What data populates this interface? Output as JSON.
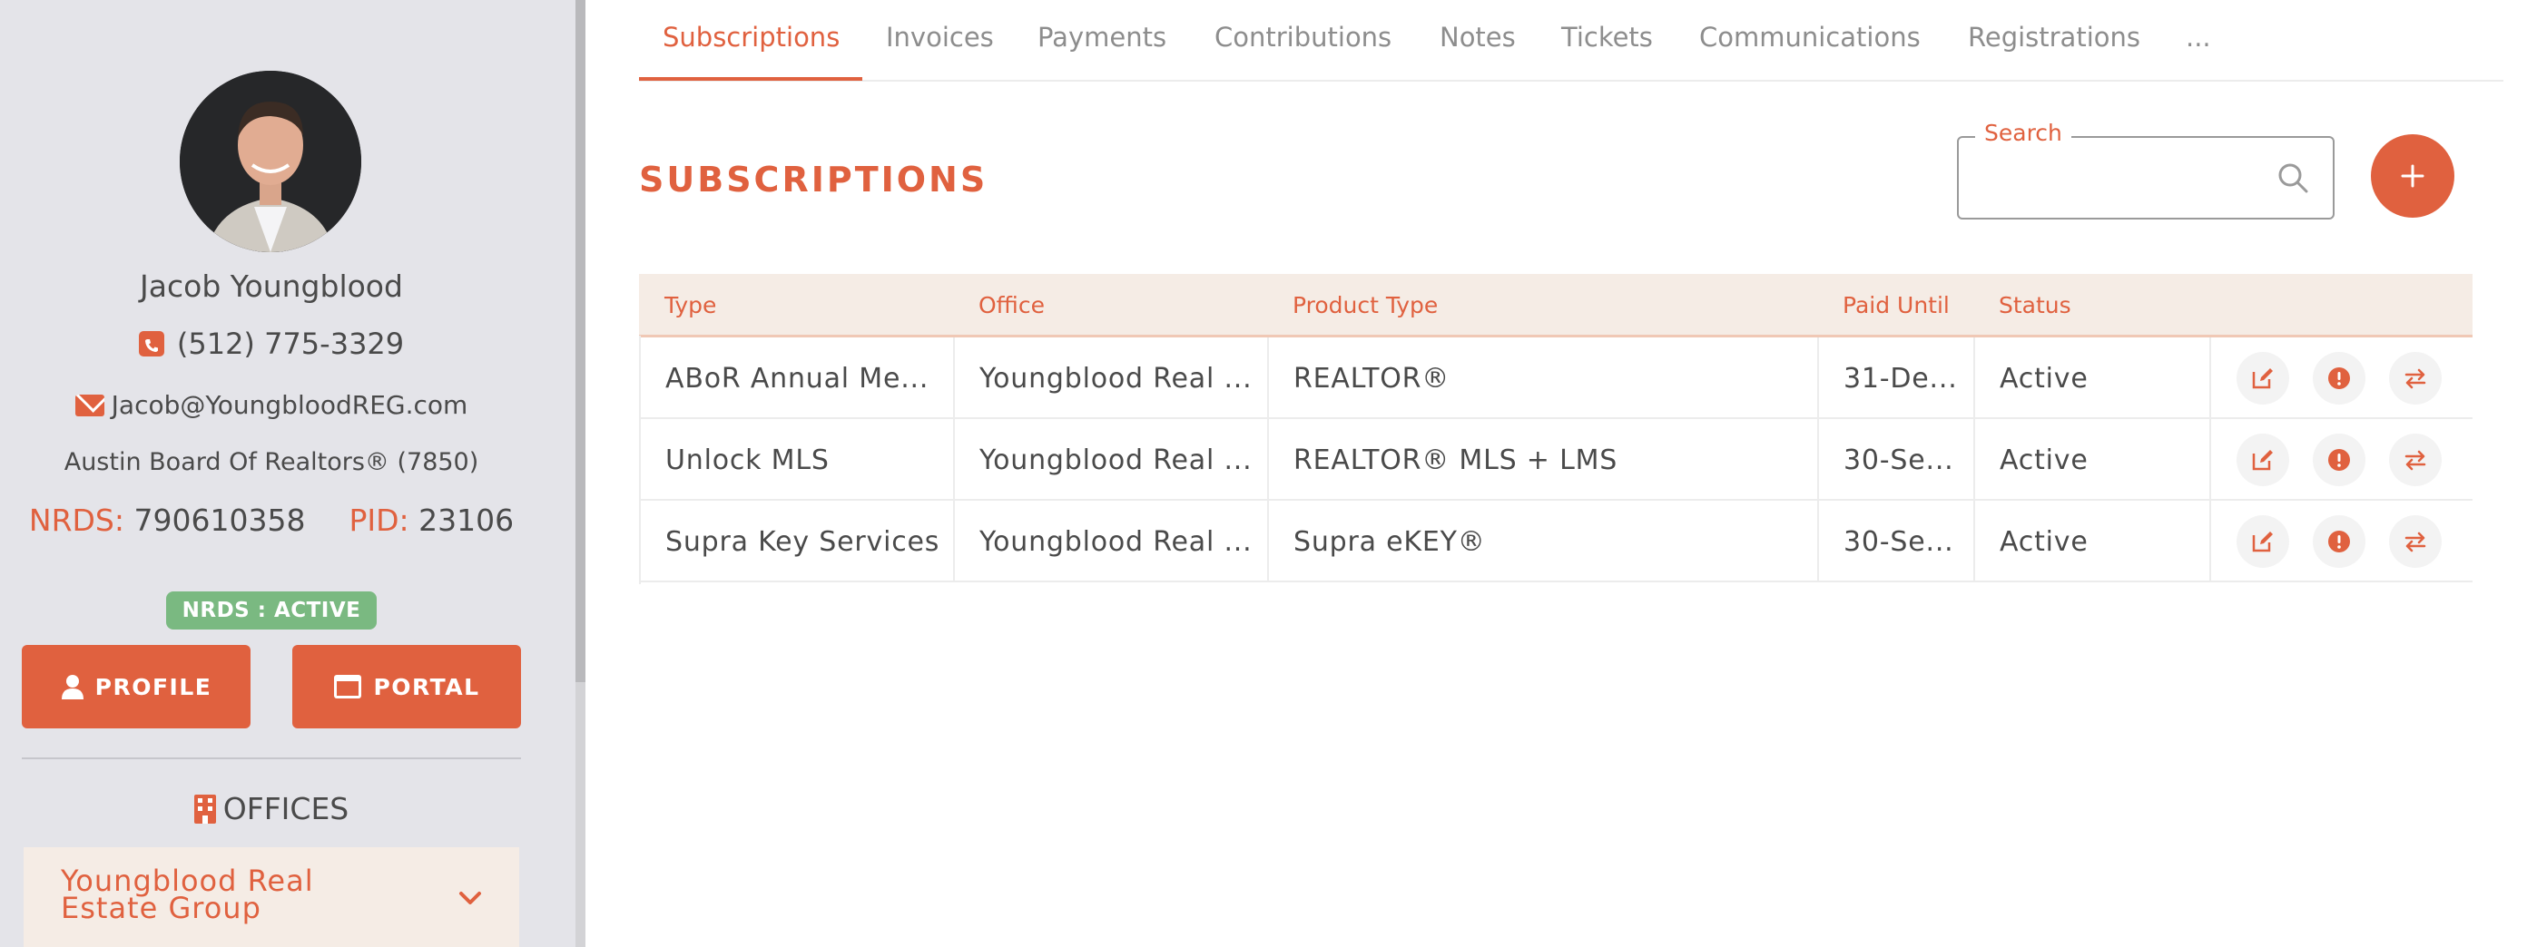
{
  "profile": {
    "name": "Jacob Youngblood",
    "phone": "(512) 775-3329",
    "email": "Jacob@YoungbloodREG.com",
    "board": "Austin Board Of Realtors® (7850)",
    "nrds_label": "NRDS:",
    "nrds_value": "790610358",
    "pid_label": "PID:",
    "pid_value": "23106",
    "status_badge": "NRDS : ACTIVE",
    "profile_button": "PROFILE",
    "portal_button": "PORTAL"
  },
  "offices": {
    "heading": "OFFICES",
    "items": [
      {
        "name": "Youngblood Real Estate Group"
      }
    ]
  },
  "tabs": [
    {
      "label": "Subscriptions",
      "active": true
    },
    {
      "label": "Invoices"
    },
    {
      "label": "Payments"
    },
    {
      "label": "Contributions"
    },
    {
      "label": "Notes"
    },
    {
      "label": "Tickets"
    },
    {
      "label": "Communications"
    },
    {
      "label": "Registrations"
    },
    {
      "label": "..."
    }
  ],
  "section": {
    "title": "SUBSCRIPTIONS",
    "search_label": "Search",
    "search_value": "",
    "add_button": "+"
  },
  "table": {
    "headers": {
      "type": "Type",
      "office": "Office",
      "product_type": "Product Type",
      "paid_until": "Paid Until",
      "status": "Status"
    },
    "rows": [
      {
        "type": "ABoR Annual Me...",
        "office": "Youngblood Real ...",
        "product_type": "REALTOR®",
        "paid_until": "31-De...",
        "status": "Active"
      },
      {
        "type": "Unlock MLS",
        "office": "Youngblood Real ...",
        "product_type": "REALTOR® MLS + LMS",
        "paid_until": "30-Se...",
        "status": "Active"
      },
      {
        "type": "Supra Key Services",
        "office": "Youngblood Real ...",
        "product_type": "Supra eKEY®",
        "paid_until": "30-Se...",
        "status": "Active"
      }
    ]
  },
  "icons": {
    "phone": "phone-icon",
    "email": "envelope-icon",
    "profile": "user-icon",
    "portal": "window-icon",
    "offices": "building-icon",
    "expand": "chevron-down-icon",
    "search": "search-icon",
    "edit": "edit-icon",
    "alert": "alert-icon",
    "transfer": "transfer-icon"
  },
  "colors": {
    "accent": "#e0613f",
    "sidebar_bg": "#e4e4e9",
    "header_bg": "#f5ece5",
    "badge_green": "#7ab981",
    "text": "#4a4a4a"
  }
}
